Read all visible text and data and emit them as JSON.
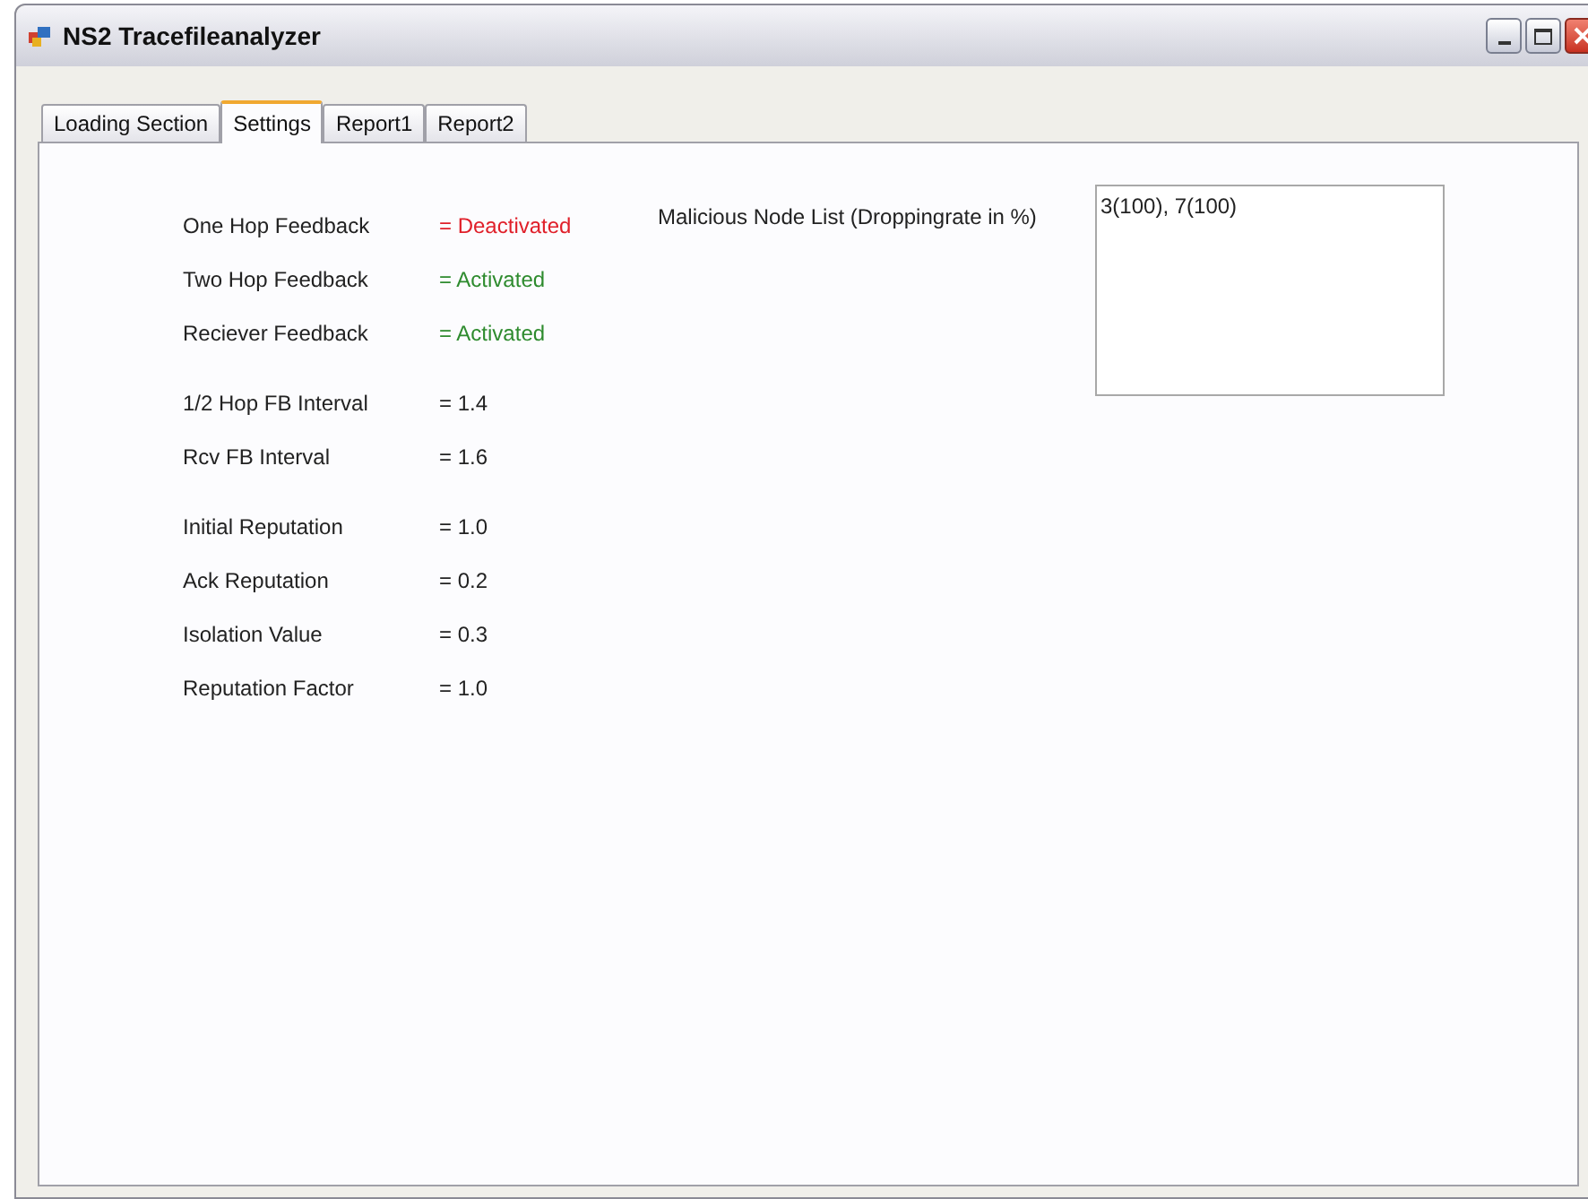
{
  "window": {
    "title": "NS2 Tracefileanalyzer"
  },
  "tabs": [
    {
      "label": "Loading Section",
      "selected": false
    },
    {
      "label": "Settings",
      "selected": true
    },
    {
      "label": "Report1",
      "selected": false
    },
    {
      "label": "Report2",
      "selected": false
    }
  ],
  "settings": [
    [
      {
        "label": "One Hop Feedback",
        "value": "= Deactivated",
        "kind": "status",
        "active": false
      },
      {
        "label": "Two Hop Feedback",
        "value": "= Activated",
        "kind": "status",
        "active": true
      },
      {
        "label": "Reciever Feedback",
        "value": "= Activated",
        "kind": "status",
        "active": true
      }
    ],
    [
      {
        "label": "1/2 Hop FB Interval",
        "value": "= 1.4",
        "kind": "number"
      },
      {
        "label": "Rcv FB Interval",
        "value": "= 1.6",
        "kind": "number"
      }
    ],
    [
      {
        "label": "Initial Reputation",
        "value": "= 1.0",
        "kind": "number"
      },
      {
        "label": "Ack Reputation",
        "value": "= 0.2",
        "kind": "number"
      },
      {
        "label": "Isolation Value",
        "value": "= 0.3",
        "kind": "number"
      },
      {
        "label": "Reputation Factor",
        "value": "= 1.0",
        "kind": "number"
      }
    ]
  ],
  "malicious": {
    "label": "Malicious Node List (Droppingrate in %)",
    "value": "3(100), 7(100)"
  }
}
